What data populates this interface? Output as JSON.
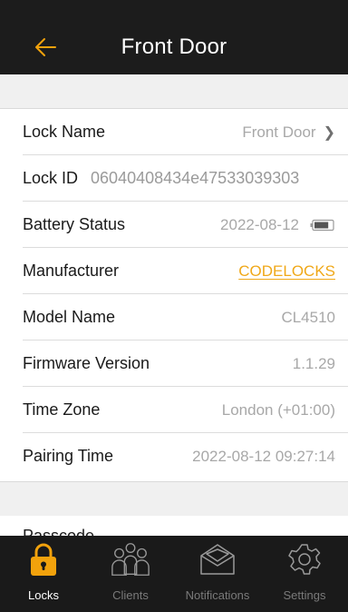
{
  "header": {
    "title": "Front Door"
  },
  "colors": {
    "accent": "#f2a20c",
    "nav_bg": "#1c1c1c",
    "tab_inactive": "#7a7a7a"
  },
  "details": {
    "lock_name": {
      "label": "Lock Name",
      "value": "Front Door"
    },
    "lock_id": {
      "label": "Lock ID",
      "value": "06040408434e47533039303"
    },
    "battery_status": {
      "label": "Battery Status",
      "value": "2022-08-12",
      "level": 0.8
    },
    "manufacturer": {
      "label": "Manufacturer",
      "value": "CODELOCKS"
    },
    "model_name": {
      "label": "Model Name",
      "value": "CL4510"
    },
    "firmware_version": {
      "label": "Firmware Version",
      "value": "1.1.29"
    },
    "time_zone": {
      "label": "Time Zone",
      "value": "London (+01:00)"
    },
    "pairing_time": {
      "label": "Pairing Time",
      "value": "2022-08-12 09:27:14"
    }
  },
  "partial_row": {
    "label": "Passcode"
  },
  "tabs": [
    {
      "label": "Locks",
      "icon": "padlock-icon",
      "active": true
    },
    {
      "label": "Clients",
      "icon": "people-icon",
      "active": false
    },
    {
      "label": "Notifications",
      "icon": "envelope-icon",
      "active": false
    },
    {
      "label": "Settings",
      "icon": "gear-icon",
      "active": false
    }
  ]
}
